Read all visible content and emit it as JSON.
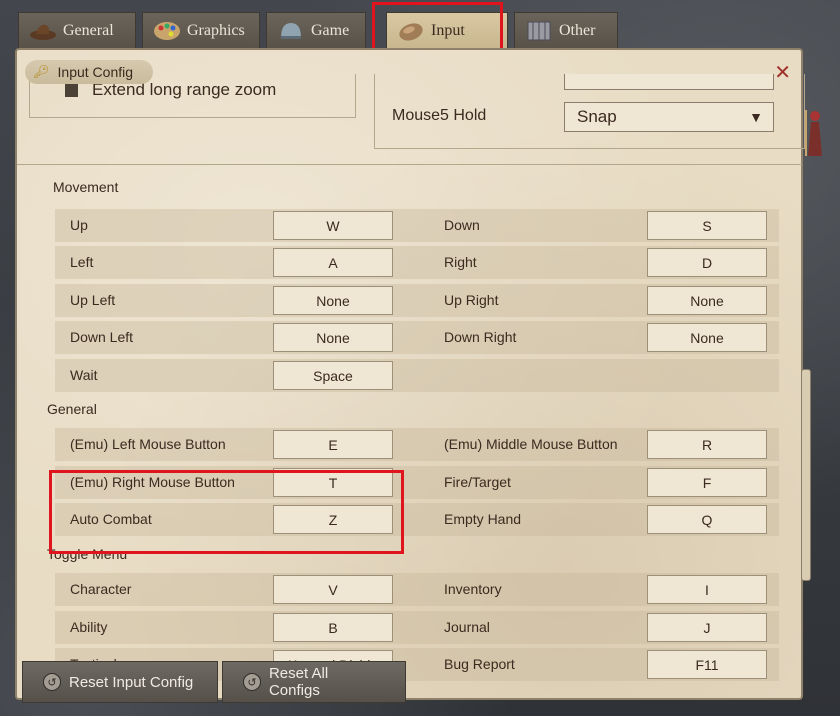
{
  "tabs": [
    {
      "label": "General",
      "icon": "hat-icon"
    },
    {
      "label": "Graphics",
      "icon": "palette-icon"
    },
    {
      "label": "Game",
      "icon": "helmet-icon"
    },
    {
      "label": "Input",
      "icon": "mouse-icon",
      "active": true
    },
    {
      "label": "Other",
      "icon": "book-icon"
    }
  ],
  "header": {
    "title": "Input Config"
  },
  "top": {
    "checkbox_label": "Extend long range zoom",
    "mouse5_label": "Mouse5 Hold",
    "mouse5_value": "Snap"
  },
  "sections": {
    "movement": "Movement",
    "general": "General",
    "toggle_menu": "Toggle Menu"
  },
  "rows": [
    {
      "left": {
        "label": "Up",
        "key": "W"
      },
      "right": {
        "label": "Down",
        "key": "S"
      }
    },
    {
      "left": {
        "label": "Left",
        "key": "A"
      },
      "right": {
        "label": "Right",
        "key": "D"
      }
    },
    {
      "left": {
        "label": "Up Left",
        "key": "None"
      },
      "right": {
        "label": "Up Right",
        "key": "None"
      }
    },
    {
      "left": {
        "label": "Down Left",
        "key": "None"
      },
      "right": {
        "label": "Down Right",
        "key": "None"
      }
    },
    {
      "left": {
        "label": "Wait",
        "key": "Space"
      },
      "right": {
        "label": "",
        "key": ""
      }
    },
    {
      "left": {
        "label": "(Emu) Left Mouse Button",
        "key": "E"
      },
      "right": {
        "label": "(Emu) Middle Mouse Button",
        "key": "R"
      }
    },
    {
      "left": {
        "label": "(Emu) Right Mouse Button",
        "key": "T"
      },
      "right": {
        "label": "Fire/Target",
        "key": "F"
      }
    },
    {
      "left": {
        "label": "Auto Combat",
        "key": "Z"
      },
      "right": {
        "label": "Empty Hand",
        "key": "Q"
      }
    },
    {
      "left": {
        "label": "Character",
        "key": "V"
      },
      "right": {
        "label": "Inventory",
        "key": "I"
      }
    },
    {
      "left": {
        "label": "Ability",
        "key": "B"
      },
      "right": {
        "label": "Journal",
        "key": "J"
      }
    },
    {
      "left": {
        "label": "Tactical",
        "key": "Keypad Divide"
      },
      "right": {
        "label": "Bug Report",
        "key": "F11"
      }
    }
  ],
  "buttons": {
    "reset_input": "Reset Input Config",
    "reset_all": "Reset All Configs"
  },
  "colors": {
    "panel_bg": "#e8dcc4",
    "highlight": "#e0141c",
    "tab_active": "#d9c8a2"
  }
}
